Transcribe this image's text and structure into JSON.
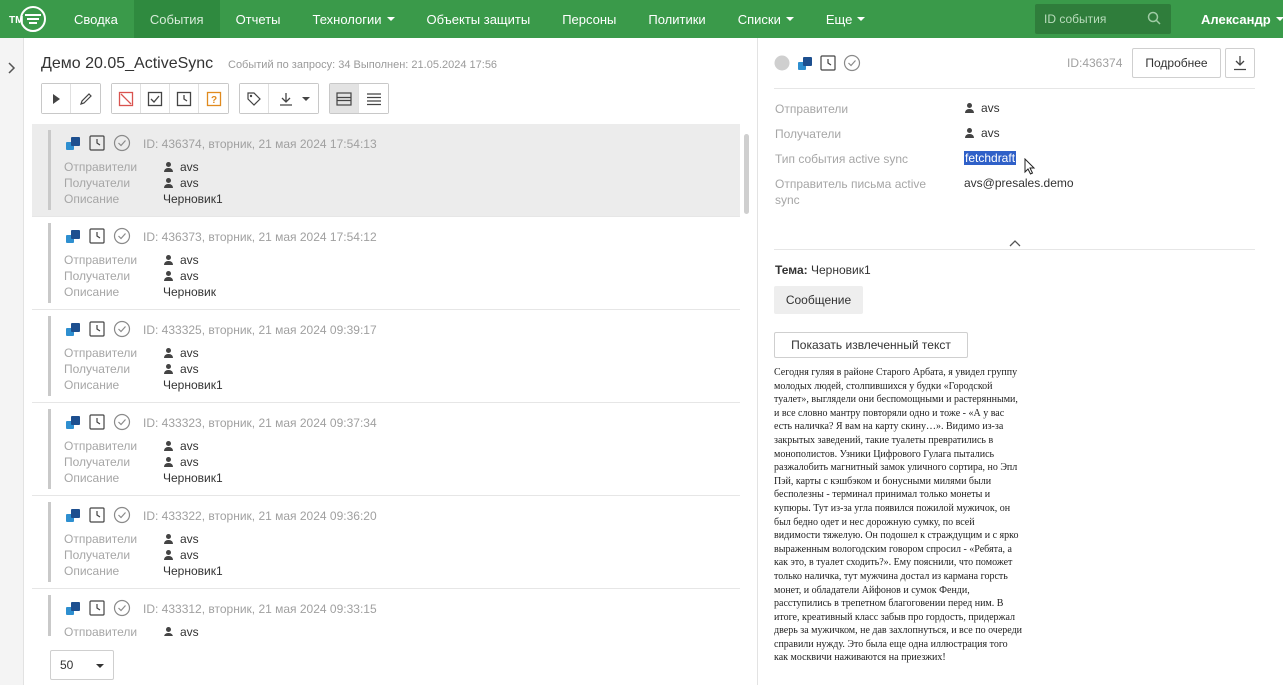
{
  "nav": {
    "logo_text": "ТМ",
    "items": [
      {
        "label": "Сводка",
        "dropdown": false,
        "active": false
      },
      {
        "label": "События",
        "dropdown": false,
        "active": true
      },
      {
        "label": "Отчеты",
        "dropdown": false,
        "active": false
      },
      {
        "label": "Технологии",
        "dropdown": true,
        "active": false
      },
      {
        "label": "Объекты защиты",
        "dropdown": false,
        "active": false
      },
      {
        "label": "Персоны",
        "dropdown": false,
        "active": false
      },
      {
        "label": "Политики",
        "dropdown": false,
        "active": false
      },
      {
        "label": "Списки",
        "dropdown": true,
        "active": false
      },
      {
        "label": "Еще",
        "dropdown": true,
        "active": false
      }
    ],
    "search_placeholder": "ID события",
    "user": "Александр"
  },
  "left": {
    "title": "Демо 20.05_ActiveSync",
    "subtitle": "Событий по запросу: 34 Выполнен: 21.05.2024 17:56",
    "labels": {
      "senders": "Отправители",
      "receivers": "Получатели",
      "description": "Описание"
    },
    "events": [
      {
        "id": "ID: 436374, вторник, 21 мая 2024 17:54:13",
        "sender": "avs",
        "receiver": "avs",
        "description": "Черновик1",
        "selected": true
      },
      {
        "id": "ID: 436373, вторник, 21 мая 2024 17:54:12",
        "sender": "avs",
        "receiver": "avs",
        "description": "Черновик",
        "selected": false
      },
      {
        "id": "ID: 433325, вторник, 21 мая 2024 09:39:17",
        "sender": "avs",
        "receiver": "avs",
        "description": "Черновик1",
        "selected": false
      },
      {
        "id": "ID: 433323, вторник, 21 мая 2024 09:37:34",
        "sender": "avs",
        "receiver": "avs",
        "description": "Черновик1",
        "selected": false
      },
      {
        "id": "ID: 433322, вторник, 21 мая 2024 09:36:20",
        "sender": "avs",
        "receiver": "avs",
        "description": "Черновик1",
        "selected": false
      },
      {
        "id": "ID: 433312, вторник, 21 мая 2024 09:33:15",
        "sender": "avs",
        "receiver": "",
        "description": "",
        "selected": false
      }
    ],
    "page_size": "50"
  },
  "right": {
    "id": "ID:436374",
    "more_label": "Подробнее",
    "fields": [
      {
        "label": "Отправители",
        "value": "avs",
        "person": true,
        "highlight": false
      },
      {
        "label": "Получатели",
        "value": "avs",
        "person": true,
        "highlight": false
      },
      {
        "label": "Тип события active sync",
        "value": "fetchdraft",
        "person": false,
        "highlight": true
      },
      {
        "label": "Отправитель письма active sync",
        "value": "avs@presales.demo",
        "person": false,
        "highlight": false
      }
    ],
    "subject_label": "Тема:",
    "subject_value": "Черновик1",
    "message_label": "Сообщение",
    "extract_label": "Показать извлеченный текст",
    "body_lines": [
      "Сегодня гуляя в районе Старого Арбата, я увидел группу",
      "молодых людей, столпившихся у будки «Городской",
      "туалет», выглядели они беспомощными и растерянными,",
      "и все словно мантру повторяли одно и тоже - «А у вас",
      "есть наличка? Я вам на карту скину…». Видимо из-за",
      "закрытых заведений, такие туалеты превратились в",
      "монополистов. Узники Цифрового Гулага пытались",
      "разжалобить магнитный замок уличного сортира, но  Эпл",
      "Пэй, карты  с кэшбэком и бонусными милями были",
      "бесполезны - терминал принимал только монеты и",
      "купюры. Тут из-за угла появился пожилой мужичок, он",
      "был бедно одет и нес  дорожную сумку, по всей",
      "видимости тяжелую. Он подошел к страждущим и с ярко",
      "выраженным вологодским говором спросил - «Ребята, а",
      "как это, в туалет сходить?». Ему пояснили, что поможет",
      "только наличка, тут мужчина достал из кармана горсть",
      "монет, и обладатели Айфонов и сумок Фенди,",
      "расступились в трепетном благоговении перед ним. В",
      "итоге, креативный класс забыв про гордость, придержал",
      "дверь за мужичком, не дав захлопнуться, и все по очереди",
      "справили нужду. Это была еще одна иллюстрация того",
      "как москвичи наживаются на приезжих!"
    ]
  },
  "colors": {
    "brand": "#3a9a4a",
    "nav_active": "#2f8a3f",
    "selection": "#2f60c8",
    "ok_icon": "#8a8a8a"
  }
}
